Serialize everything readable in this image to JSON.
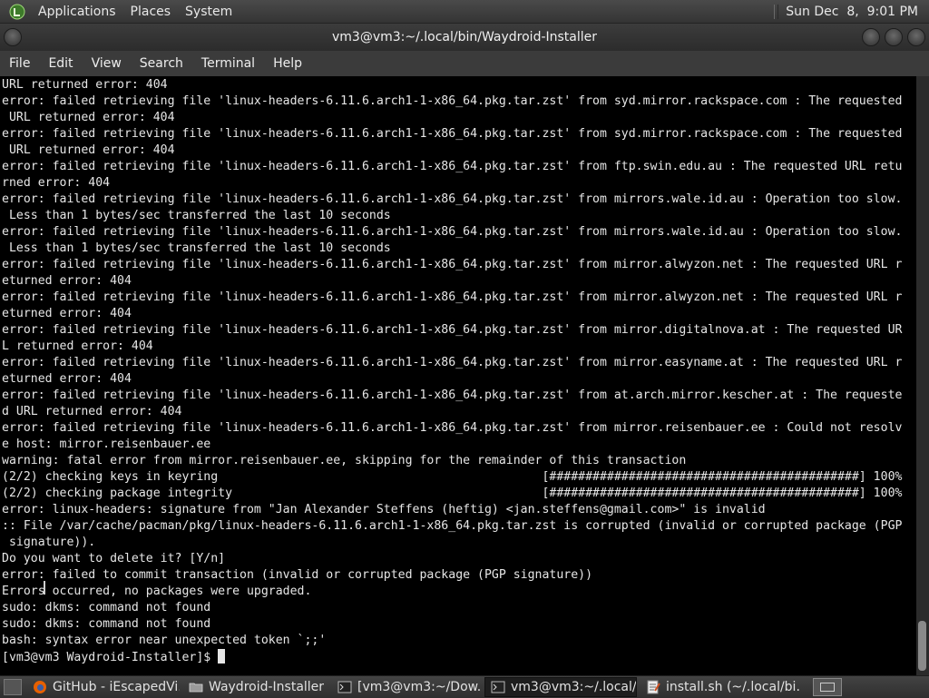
{
  "top_panel": {
    "menus": [
      "Applications",
      "Places",
      "System"
    ],
    "clock": "Sun Dec  8,  9:01 PM"
  },
  "window": {
    "title": "vm3@vm3:~/.local/bin/Waydroid-Installer"
  },
  "menubar": [
    "File",
    "Edit",
    "View",
    "Search",
    "Terminal",
    "Help"
  ],
  "terminal": {
    "lines": [
      "URL returned error: 404",
      "error: failed retrieving file 'linux-headers-6.11.6.arch1-1-x86_64.pkg.tar.zst' from syd.mirror.rackspace.com : The requested",
      " URL returned error: 404",
      "error: failed retrieving file 'linux-headers-6.11.6.arch1-1-x86_64.pkg.tar.zst' from syd.mirror.rackspace.com : The requested",
      " URL returned error: 404",
      "error: failed retrieving file 'linux-headers-6.11.6.arch1-1-x86_64.pkg.tar.zst' from ftp.swin.edu.au : The requested URL retu",
      "rned error: 404",
      "error: failed retrieving file 'linux-headers-6.11.6.arch1-1-x86_64.pkg.tar.zst' from mirrors.wale.id.au : Operation too slow.",
      " Less than 1 bytes/sec transferred the last 10 seconds",
      "error: failed retrieving file 'linux-headers-6.11.6.arch1-1-x86_64.pkg.tar.zst' from mirrors.wale.id.au : Operation too slow.",
      " Less than 1 bytes/sec transferred the last 10 seconds",
      "error: failed retrieving file 'linux-headers-6.11.6.arch1-1-x86_64.pkg.tar.zst' from mirror.alwyzon.net : The requested URL r",
      "eturned error: 404",
      "error: failed retrieving file 'linux-headers-6.11.6.arch1-1-x86_64.pkg.tar.zst' from mirror.alwyzon.net : The requested URL r",
      "eturned error: 404",
      "error: failed retrieving file 'linux-headers-6.11.6.arch1-1-x86_64.pkg.tar.zst' from mirror.digitalnova.at : The requested UR",
      "L returned error: 404",
      "error: failed retrieving file 'linux-headers-6.11.6.arch1-1-x86_64.pkg.tar.zst' from mirror.easyname.at : The requested URL r",
      "eturned error: 404",
      "error: failed retrieving file 'linux-headers-6.11.6.arch1-1-x86_64.pkg.tar.zst' from at.arch.mirror.kescher.at : The requeste",
      "d URL returned error: 404",
      "error: failed retrieving file 'linux-headers-6.11.6.arch1-1-x86_64.pkg.tar.zst' from mirror.reisenbauer.ee : Could not resolv",
      "e host: mirror.reisenbauer.ee",
      "warning: fatal error from mirror.reisenbauer.ee, skipping for the remainder of this transaction",
      "(2/2) checking keys in keyring                                             [###########################################] 100%",
      "(2/2) checking package integrity                                           [###########################################] 100%",
      "error: linux-headers: signature from \"Jan Alexander Steffens (heftig) <jan.steffens@gmail.com>\" is invalid",
      ":: File /var/cache/pacman/pkg/linux-headers-6.11.6.arch1-1-x86_64.pkg.tar.zst is corrupted (invalid or corrupted package (PGP",
      " signature)).",
      "Do you want to delete it? [Y/n]",
      "error: failed to commit transaction (invalid or corrupted package (PGP signature))",
      "Errors occurred, no packages were upgraded.",
      "sudo: dkms: command not found",
      "sudo: dkms: command not found",
      "bash: syntax error near unexpected token `;;'"
    ],
    "prompt": "[vm3@vm3 Waydroid-Installer]$ "
  },
  "taskbar": {
    "tasks": [
      {
        "label": "GitHub - iEscapedVi...",
        "icon": "firefox-icon",
        "active": false
      },
      {
        "label": "Waydroid-Installer",
        "icon": "folder-icon",
        "active": false
      },
      {
        "label": "[vm3@vm3:~/Dow...",
        "icon": "terminal-icon",
        "active": false
      },
      {
        "label": "vm3@vm3:~/.local/...",
        "icon": "terminal-icon",
        "active": true
      },
      {
        "label": "install.sh (~/.local/bi...",
        "icon": "text-editor-icon",
        "active": false
      }
    ]
  },
  "colors": {
    "terminal_bg": "#000000",
    "terminal_fg": "#e6e6e6",
    "panel_bg": "#3b3b3b",
    "firefox_orange": "#e66000"
  }
}
